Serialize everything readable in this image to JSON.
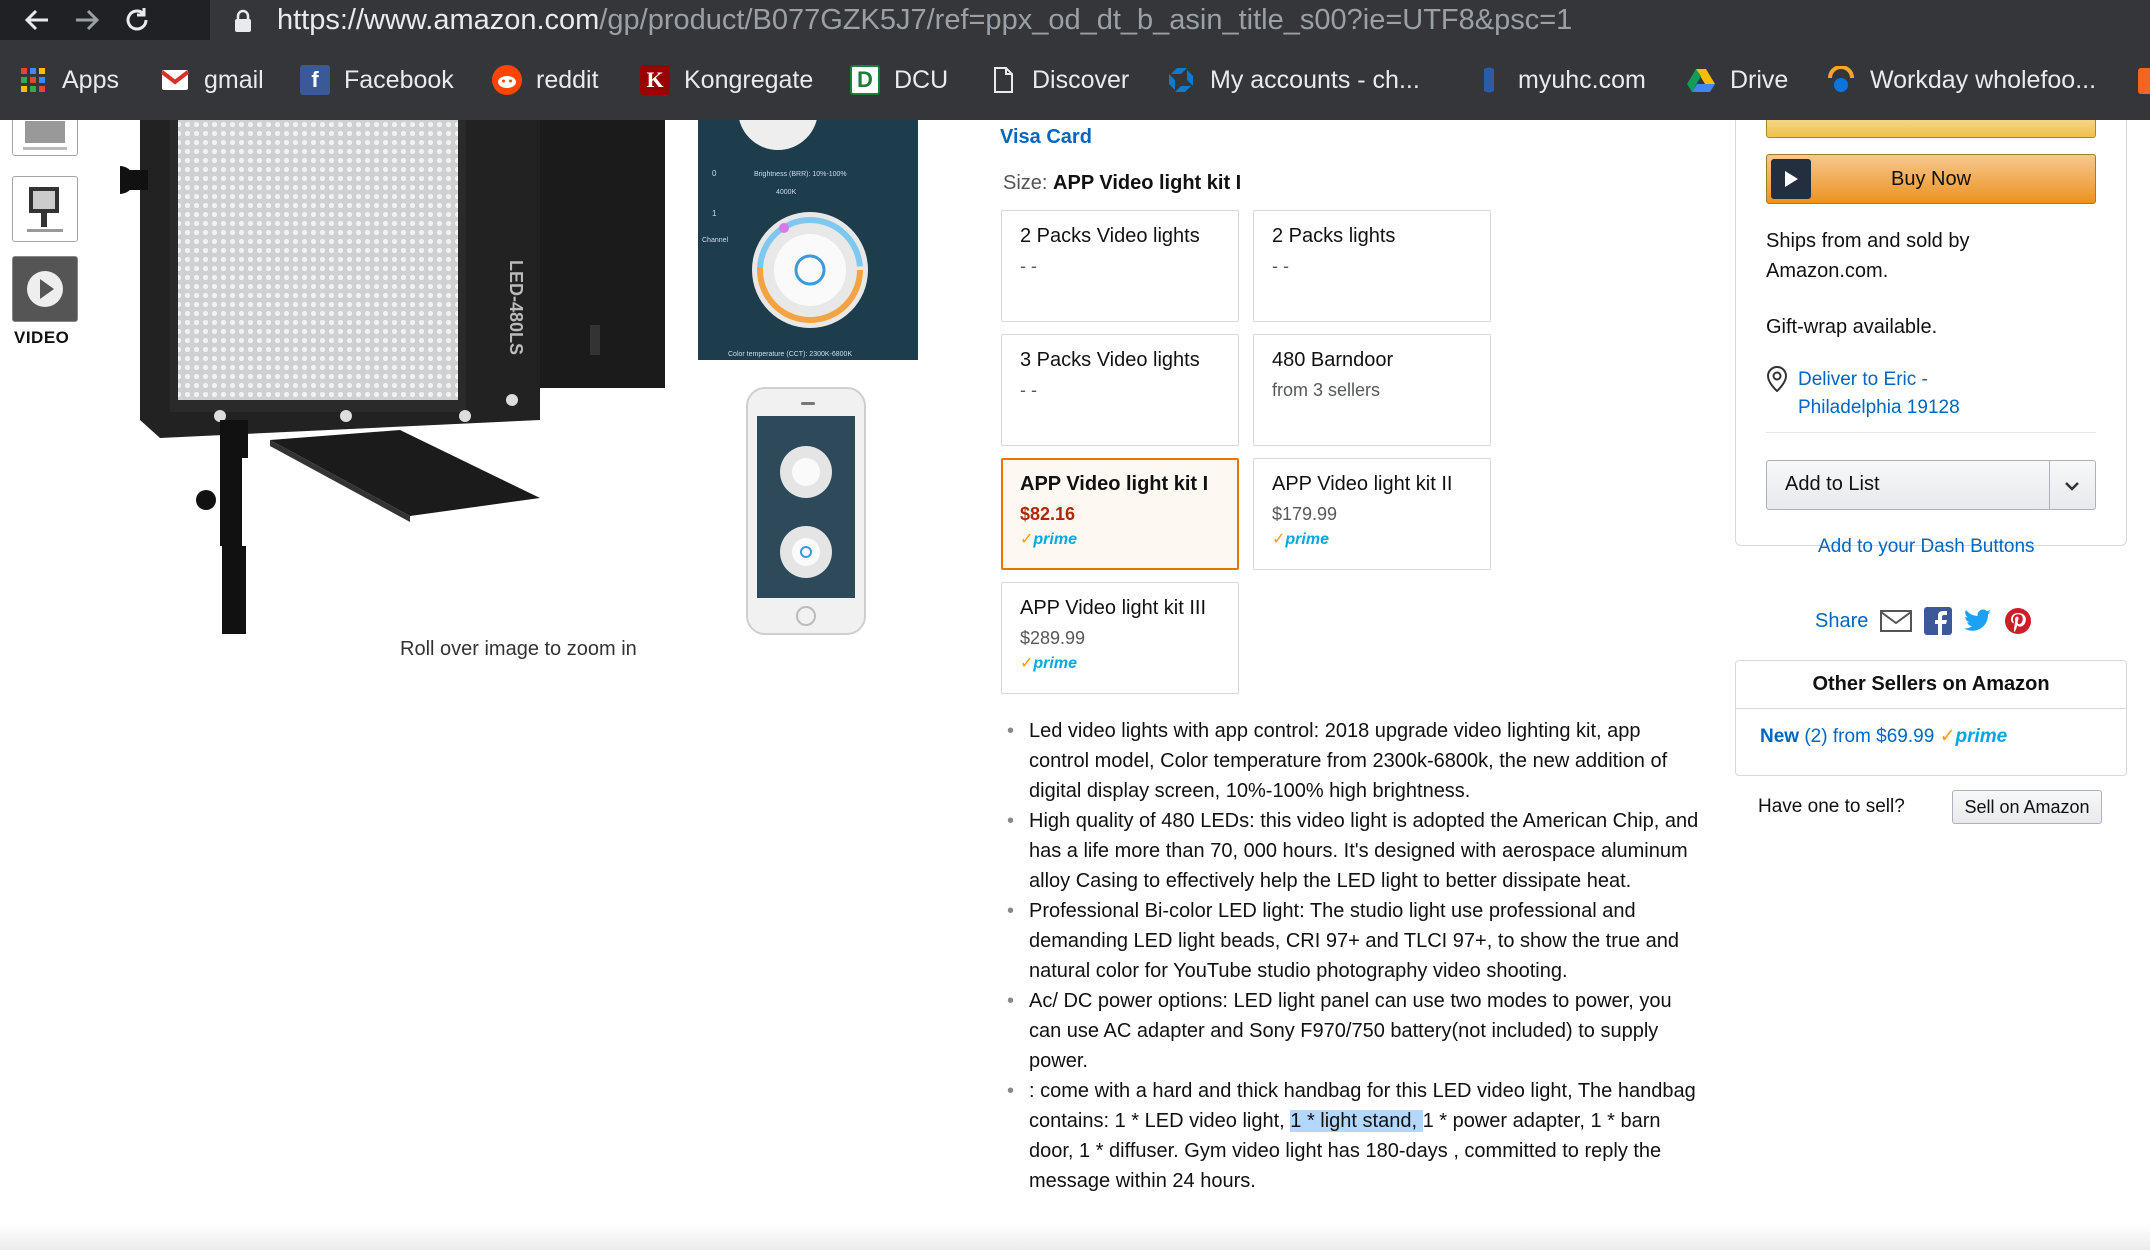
{
  "browser": {
    "url_host": "https://www.amazon.com",
    "url_path": "/gp/product/B077GZK5J7/ref=ppx_od_dt_b_asin_title_s00?ie=UTF8&psc=1",
    "bookmarks": [
      {
        "label": "Apps",
        "icon": "apps-grid-icon"
      },
      {
        "label": "gmail",
        "icon": "gmail-icon"
      },
      {
        "label": "Facebook",
        "icon": "facebook-icon"
      },
      {
        "label": "reddit",
        "icon": "reddit-icon"
      },
      {
        "label": "Kongregate",
        "icon": "kongregate-icon"
      },
      {
        "label": "DCU",
        "icon": "dcu-icon"
      },
      {
        "label": "Discover",
        "icon": "page-icon"
      },
      {
        "label": "My accounts - ch...",
        "icon": "chase-icon"
      },
      {
        "label": "myuhc.com",
        "icon": "uhc-icon"
      },
      {
        "label": "Drive",
        "icon": "drive-icon"
      },
      {
        "label": "Workday wholefoo...",
        "icon": "workday-icon"
      }
    ]
  },
  "gallery": {
    "video_label": "VIDEO",
    "zoom_hint": "Roll over image to zoom in",
    "main_image_text": "LED-480LS",
    "side_image_texts": {
      "brightness": "Brightness (BRR): 10%-100%",
      "value": "4000K",
      "channel": "Channel",
      "cct": "Color temperature (CCT): 2300K-6800K"
    }
  },
  "product": {
    "payment_link": "Visa Card",
    "size_label": "Size:",
    "size_value": "APP Video light kit I",
    "options": [
      {
        "title": "2 Packs Video lights",
        "sub": "- -"
      },
      {
        "title": "2 Packs lights",
        "sub": "- -"
      },
      {
        "title": "3 Packs Video lights",
        "sub": "- -"
      },
      {
        "title": "480 Barndoor",
        "sub": "from 3 sellers"
      },
      {
        "title": "APP Video light kit I",
        "price": "$82.16",
        "prime": "prime",
        "selected": true
      },
      {
        "title": "APP Video light kit II",
        "price": "$179.99",
        "prime": "prime"
      },
      {
        "title": "APP Video light kit III",
        "price": "$289.99",
        "prime": "prime"
      }
    ],
    "bullets": [
      "Led video lights with app control: 2018 upgrade video lighting kit, app control model, Color temperature from 2300k-6800k, the new addition of digital display screen, 10%-100% high brightness.",
      "High quality of 480 LEDs: this video light is adopted the American Chip, and has a life more than 70, 000 hours. It's designed with aerospace aluminum alloy Casing to effectively help the LED light to better dissipate heat.",
      "Professional Bi-color LED light: The studio light use professional and demanding LED light beads, CRI 97+ and TLCI 97+, to show the true and natural color for YouTube studio photography video shooting.",
      "Ac/ DC power options: LED light panel can use two modes to power, you can use AC adapter and Sony F970/750 battery(not included) to supply power."
    ],
    "bullet5_before": ": come with a hard and thick handbag for this LED video light, The handbag contains: 1 * LED video light, ",
    "bullet5_highlight": "1 * light stand, ",
    "bullet5_after": "1 * power adapter, 1 * barn door, 1 * diffuser. Gym video light has 180-days , committed to reply the message within 24 hours."
  },
  "buybox": {
    "buy_now": "Buy Now",
    "ships": "Ships from and sold by Amazon.com.",
    "gift": "Gift-wrap available.",
    "deliver_line1": "Deliver to Eric -",
    "deliver_line2": "Philadelphia 19128",
    "add_to_list": "Add to List",
    "dash_buttons": "Add to your Dash Buttons",
    "share": "Share"
  },
  "other_sellers": {
    "header": "Other Sellers on Amazon",
    "new_label": "New",
    "count": "(2)",
    "from_text": "from $69.99",
    "prime": "prime",
    "have_one": "Have one to sell?",
    "sell_button": "Sell on Amazon"
  }
}
